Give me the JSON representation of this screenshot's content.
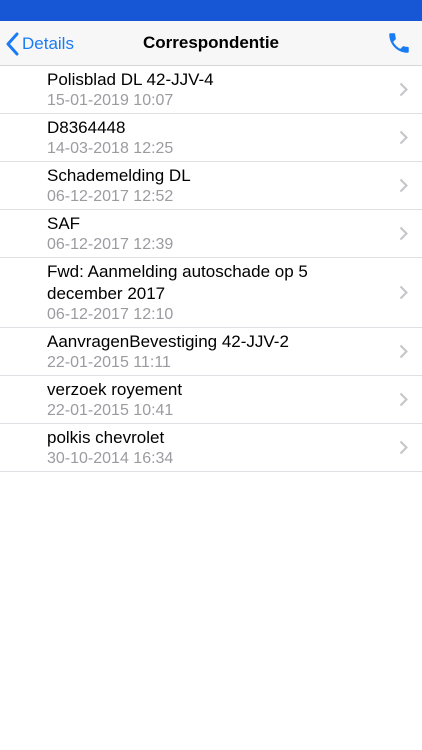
{
  "header": {
    "back_label": "Details",
    "title": "Correspondentie",
    "back_icon": "chevron-left-icon",
    "action_icon": "phone-icon",
    "accent_color": "#1a7cf3",
    "status_bar_color": "#1756d4"
  },
  "items": [
    {
      "title": "Polisblad DL 42-JJV-4",
      "date": "15-01-2019 10:07"
    },
    {
      "title": "D8364448",
      "date": "14-03-2018 12:25"
    },
    {
      "title": "Schademelding DL",
      "date": "06-12-2017 12:52"
    },
    {
      "title": "SAF",
      "date": "06-12-2017 12:39"
    },
    {
      "title": "Fwd: Aanmelding autoschade op 5 december 2017",
      "date": "06-12-2017 12:10"
    },
    {
      "title": "AanvragenBevestiging 42-JJV-2",
      "date": "22-01-2015 11:11"
    },
    {
      "title": "verzoek royement",
      "date": "22-01-2015 10:41"
    },
    {
      "title": "polkis chevrolet",
      "date": "30-10-2014 16:34"
    }
  ]
}
